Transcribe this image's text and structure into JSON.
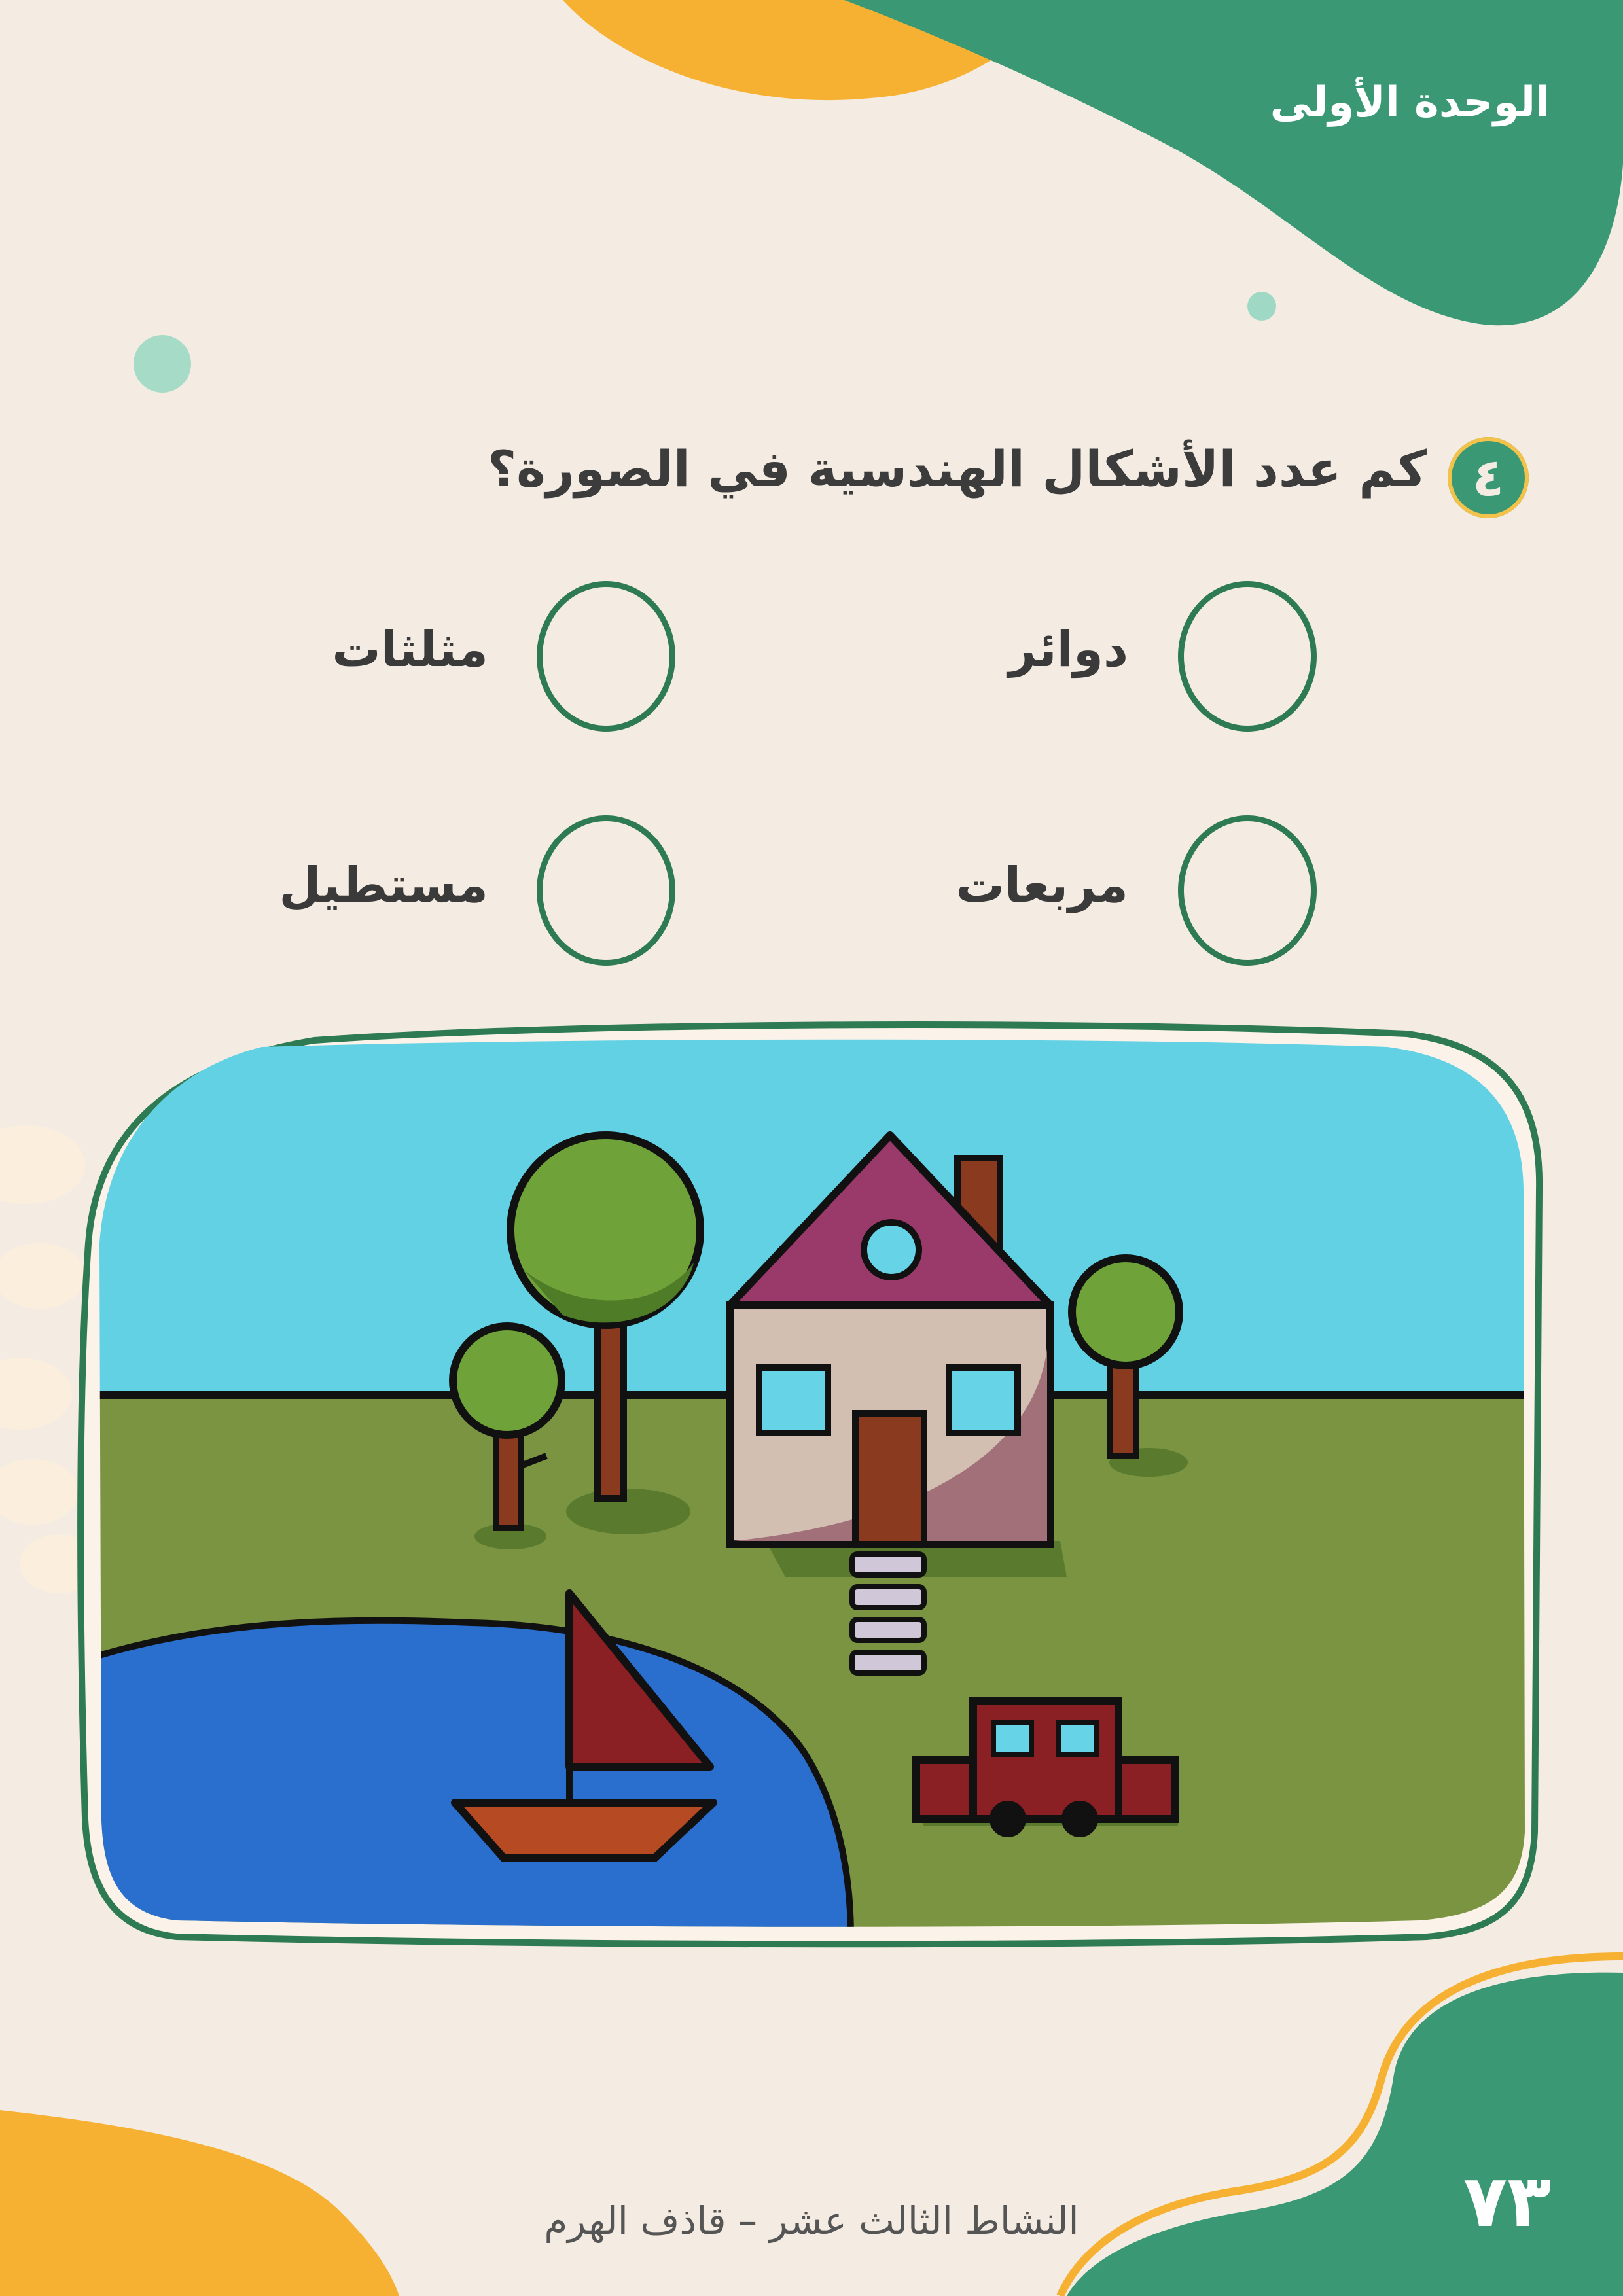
{
  "header": {
    "unit_title": "الوحدة الأولى"
  },
  "question": {
    "number": "٤",
    "text": "كم عدد الأشكال الهندسية في الصورة؟"
  },
  "options": {
    "circles": "دوائر",
    "triangles": "مثلثات",
    "squares": "مربعات",
    "rectangle": "مستطيل"
  },
  "footer": {
    "page_number": "٧٣",
    "activity_text": "النشاط الثالث عشر – قاذف الهرم"
  },
  "colors": {
    "background": "#f4ece2",
    "accent_green": "#3a9974",
    "accent_orange": "#f6b133",
    "sky": "#62d1e4",
    "grass": "#7a9441",
    "water": "#2a6ece"
  }
}
